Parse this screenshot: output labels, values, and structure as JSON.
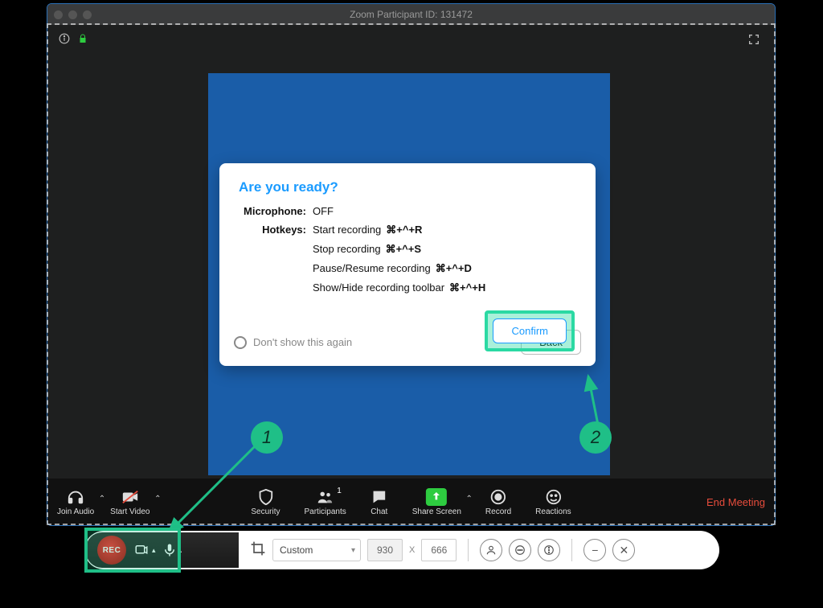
{
  "window": {
    "title": "Zoom Participant ID: 131472"
  },
  "dialog": {
    "title": "Are you ready?",
    "mic_label": "Microphone:",
    "mic_value": "OFF",
    "hotkeys_label": "Hotkeys:",
    "hotkeys": [
      {
        "desc": "Start recording",
        "keys": "⌘+^+R"
      },
      {
        "desc": "Stop recording",
        "keys": "⌘+^+S"
      },
      {
        "desc": "Pause/Resume recording",
        "keys": "⌘+^+D"
      },
      {
        "desc": "Show/Hide recording toolbar",
        "keys": "⌘+^+H"
      }
    ],
    "dont_show": "Don't show this again",
    "back": "Back",
    "confirm": "Confirm"
  },
  "markers": {
    "one": "1",
    "two": "2"
  },
  "toolbar": {
    "join_audio": "Join Audio",
    "start_video": "Start Video",
    "security": "Security",
    "participants": "Participants",
    "participants_count": "1",
    "chat": "Chat",
    "share": "Share Screen",
    "record": "Record",
    "reactions": "Reactions",
    "end": "End Meeting"
  },
  "recorder": {
    "rec": "REC",
    "mode": "Custom",
    "width": "930",
    "x": "X",
    "height": "666"
  }
}
